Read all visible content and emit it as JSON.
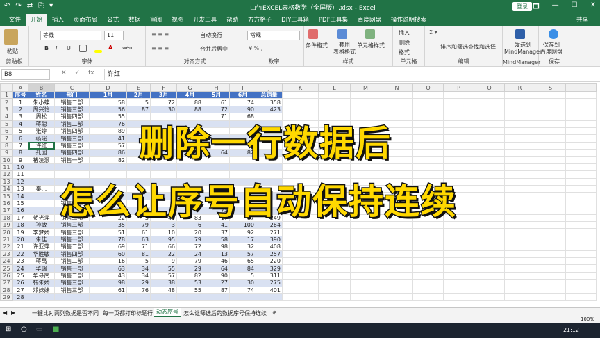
{
  "titlebar": {
    "title": "山竹EXCEL表格教学（全屏版）.xlsx - Excel",
    "login": "登录",
    "quick_access": [
      "↶",
      "↷",
      "⇄",
      "⎘",
      "▾"
    ],
    "window_controls": [
      "🗖",
      "—",
      "☐",
      "✕"
    ]
  },
  "tabs": [
    "文件",
    "开始",
    "插入",
    "页面布局",
    "公式",
    "数据",
    "审阅",
    "视图",
    "开发工具",
    "帮助",
    "方方格子",
    "DIY工具箱",
    "PDF工具集",
    "百度网盘",
    "操作说明搜索"
  ],
  "active_tab": "开始",
  "share": "共享",
  "ribbon": {
    "clipboard": {
      "paste": "粘贴",
      "label": "剪贴板"
    },
    "font": {
      "name": "等线",
      "size": "11",
      "bold": "B",
      "italic": "I",
      "underline": "U",
      "label": "字体",
      "wen": "wén"
    },
    "alignment": {
      "wrap": "自动换行",
      "merge": "合并后居中",
      "label": "对齐方式"
    },
    "number": {
      "format": "常规",
      "label": "数字"
    },
    "styles": {
      "cond": "条件格式",
      "table": "套用\n表格格式",
      "cell": "单元格样式",
      "label": "样式"
    },
    "cells": {
      "insert": "插入",
      "delete": "删除",
      "format": "格式",
      "label": "单元格"
    },
    "editing": {
      "sort": "排序和筛选",
      "find": "查找和选择",
      "label": "编辑"
    },
    "mindmanager": {
      "send": "发送到\nMindManager",
      "label": "MindManager"
    },
    "save": {
      "save": "保存到\n百度网盘",
      "label": "保存"
    }
  },
  "formula_bar": {
    "cell": "B8",
    "value": "许红",
    "icons": [
      "✕",
      "✓",
      "fx"
    ]
  },
  "columns": [
    "A",
    "B",
    "C",
    "D",
    "E",
    "F",
    "G",
    "H",
    "I",
    "J",
    "K",
    "L",
    "M",
    "N",
    "O",
    "P",
    "Q",
    "R",
    "S",
    "T"
  ],
  "selected_cell": {
    "row": 8,
    "col": "B"
  },
  "headers": [
    "序号",
    "姓名",
    "部门",
    "1月",
    "2月",
    "3月",
    "4月",
    "5月",
    "6月",
    "总销量"
  ],
  "rows": [
    [
      "1",
      "朱小蝶",
      "销售二部",
      "58",
      "5",
      "72",
      "88",
      "61",
      "74",
      "358"
    ],
    [
      "2",
      "周兴怡",
      "销售三部",
      "56",
      "87",
      "30",
      "88",
      "72",
      "90",
      "423"
    ],
    [
      "3",
      "周松",
      "销售四部",
      "55",
      "",
      "",
      "",
      "71",
      "68",
      ""
    ],
    [
      "4",
      "蒋聪",
      "销售二部",
      "76",
      "",
      "",
      "",
      "",
      "",
      ""
    ],
    [
      "5",
      "张婷",
      "销售四部",
      "89",
      "",
      "",
      "",
      "",
      "",
      ""
    ],
    [
      "6",
      "杨瑶",
      "销售三部",
      "41",
      "",
      "",
      "",
      "",
      "",
      ""
    ],
    [
      "7",
      "许红",
      "销售三部",
      "57",
      "",
      "",
      "",
      "",
      "",
      ""
    ],
    [
      "8",
      "孔园",
      "销售四部",
      "86",
      "",
      "",
      "",
      "64",
      "82",
      ""
    ],
    [
      "9",
      "褚凌灏",
      "销售一部",
      "82",
      "",
      "",
      "",
      "",
      "",
      ""
    ],
    [
      "10",
      "",
      "",
      "",
      "",
      "",
      "",
      "",
      "",
      ""
    ],
    [
      "11",
      "",
      "",
      "",
      "",
      "",
      "",
      "",
      "",
      ""
    ],
    [
      "12",
      "",
      "",
      "",
      "",
      "",
      "",
      "",
      "",
      ""
    ],
    [
      "13",
      "秦...",
      "",
      "",
      "",
      "",
      "",
      "",
      "",
      ""
    ],
    [
      "14",
      "",
      "",
      "",
      "",
      "",
      "",
      "",
      "",
      ""
    ],
    [
      "15",
      "",
      "销售四部",
      "",
      "",
      "",
      "",
      "",
      "",
      ""
    ],
    [
      "16",
      "",
      "",
      "",
      "",
      "",
      "",
      "73",
      "",
      ""
    ],
    [
      "17",
      "贺光萍",
      "销售三部",
      "22",
      "3",
      "40",
      "83",
      "17",
      "87",
      "249"
    ],
    [
      "18",
      "孙敏",
      "销售三部",
      "35",
      "79",
      "3",
      "6",
      "41",
      "100",
      "264"
    ],
    [
      "19",
      "李梦娇",
      "销售三部",
      "51",
      "61",
      "10",
      "20",
      "37",
      "92",
      "271"
    ],
    [
      "20",
      "朱佳",
      "销售一部",
      "78",
      "63",
      "95",
      "79",
      "58",
      "17",
      "390"
    ],
    [
      "21",
      "许亚萍",
      "销售二部",
      "69",
      "71",
      "66",
      "72",
      "98",
      "32",
      "408"
    ],
    [
      "22",
      "华胜敏",
      "销售四部",
      "60",
      "81",
      "22",
      "24",
      "13",
      "57",
      "257"
    ],
    [
      "23",
      "蒋禹",
      "销售二部",
      "16",
      "5",
      "9",
      "79",
      "46",
      "65",
      "220"
    ],
    [
      "24",
      "华瑞",
      "销售一部",
      "63",
      "34",
      "55",
      "29",
      "64",
      "84",
      "329"
    ],
    [
      "25",
      "华寻南",
      "销售二部",
      "43",
      "34",
      "57",
      "82",
      "90",
      "5",
      "311"
    ],
    [
      "26",
      "韩朱娇",
      "销售三部",
      "98",
      "29",
      "38",
      "53",
      "27",
      "30",
      "275"
    ],
    [
      "27",
      "邓妹妹",
      "销售三部",
      "61",
      "76",
      "48",
      "55",
      "87",
      "74",
      "401"
    ],
    [
      "28",
      "",
      "",
      "",
      "",
      "",
      "",
      "",
      "",
      ""
    ]
  ],
  "overlay": {
    "line1": "删除一行数据后",
    "line2": "怎么让序号自动保持连续"
  },
  "sheet_tabs": [
    "一键比对两列数据是否不同",
    "每一页都打印标题行",
    "动态序号",
    "怎么让筛选后的数据序号保持连续"
  ],
  "active_sheet": "动态序号",
  "sheet_tab_controls": [
    "◀",
    "▶",
    "..."
  ],
  "add_sheet": "⊕",
  "status": {
    "zoom": "100%"
  },
  "taskbar": {
    "time": "21:12"
  }
}
